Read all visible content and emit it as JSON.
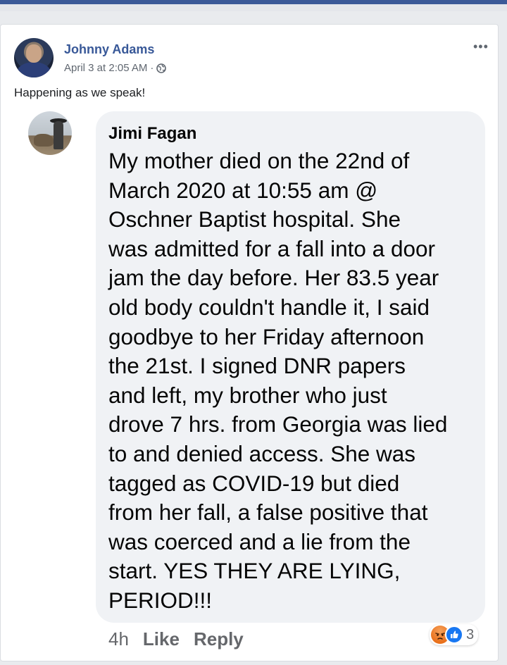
{
  "post": {
    "author": "Johnny Adams",
    "date": "April 3 at 2:05 AM",
    "separator": "·",
    "privacy_icon": "globe-icon",
    "more_icon": "•••",
    "text": "Happening as we speak!"
  },
  "comment": {
    "author": "Jimi Fagan",
    "text": "My mother died on the 22nd of\nMarch 2020 at 10:55 am @\nOschner Baptist hospital. She\nwas admitted for a fall into a door\njam the day before. Her 83.5 year\nold body couldn't handle it, I said\ngoodbye to her Friday afternoon\nthe 21st. I signed DNR papers\nand left, my brother who just\ndrove 7 hrs. from Georgia was lied\nto and denied access. She was\ntagged as COVID-19 but died\nfrom her fall, a false positive that\nwas coerced and a lie from the\nstart. YES THEY ARE LYING,\nPERIOD!!!",
    "time": "4h",
    "like_label": "Like",
    "reply_label": "Reply",
    "reactions": [
      "angry",
      "like"
    ],
    "reaction_count": "3"
  },
  "colors": {
    "link": "#385898",
    "bubble": "#f0f2f5",
    "meta": "#606770",
    "like_blue": "#1877f2",
    "angry_orange": "#e9711c"
  }
}
